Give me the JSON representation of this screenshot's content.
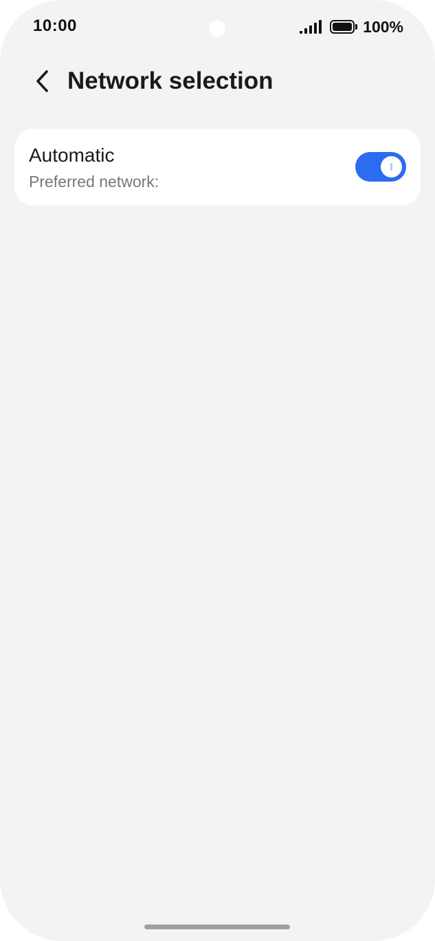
{
  "status_bar": {
    "time": "10:00",
    "battery_text": "100%",
    "signal_icon": "signal-bars-icon",
    "battery_icon": "battery-full-icon"
  },
  "header": {
    "back_icon": "chevron-left-icon",
    "title": "Network selection"
  },
  "automatic_setting": {
    "title": "Automatic",
    "subtitle": "Preferred network:",
    "toggle_on": true
  },
  "colors": {
    "background": "#f2f3f5",
    "card": "#ffffff",
    "accent": "#2b6cf0",
    "toggle_off": "#c8c8cc"
  }
}
